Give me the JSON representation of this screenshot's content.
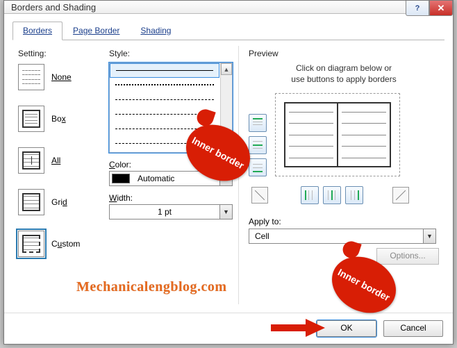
{
  "window": {
    "title": "Borders and Shading"
  },
  "tabs": {
    "borders": "Borders",
    "page_border": "Page Border",
    "shading": "Shading"
  },
  "settings": {
    "heading": "Setting:",
    "none": "None",
    "box": "Box",
    "all": "All",
    "grid": "Grid",
    "custom": "Custom"
  },
  "style": {
    "heading": "Style:",
    "color_label": "Color:",
    "color_value": "Automatic",
    "width_label": "Width:",
    "width_value": "1 pt"
  },
  "preview": {
    "heading": "Preview",
    "hint_line1": "Click on diagram below or",
    "hint_line2": "use buttons to apply borders",
    "apply_to_label": "Apply to:",
    "apply_to_value": "Cell",
    "options_label": "Options..."
  },
  "footer": {
    "ok": "OK",
    "cancel": "Cancel"
  },
  "annotations": {
    "callout1": "Inner border",
    "callout2": "Inner border",
    "watermark": "Mechanicalengblog.com"
  }
}
